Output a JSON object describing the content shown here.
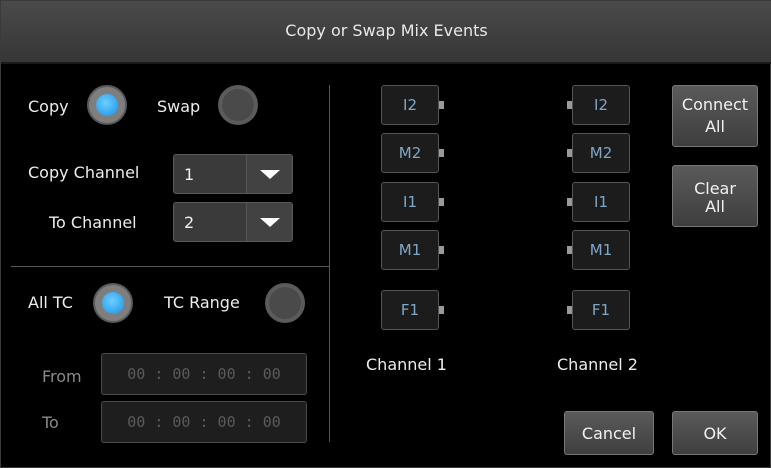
{
  "window": {
    "title": "Copy or Swap Mix Events"
  },
  "mode": {
    "copy_label": "Copy",
    "swap_label": "Swap",
    "selected": "Copy"
  },
  "channels": {
    "copy_label": "Copy Channel",
    "copy_value": "1",
    "to_label": "To Channel",
    "to_value": "2"
  },
  "tc": {
    "all_label": "All TC",
    "range_label": "TC Range",
    "selected": "All TC",
    "from_label": "From",
    "from_value": "00 : 00 : 00 : 00",
    "to_label": "To",
    "to_value": "00 : 00 : 00 : 00"
  },
  "events": {
    "channel1": {
      "label": "Channel 1",
      "items": [
        "I2",
        "M2",
        "I1",
        "M1",
        "F1"
      ]
    },
    "channel2": {
      "label": "Channel 2",
      "items": [
        "I2",
        "M2",
        "I1",
        "M1",
        "F1"
      ]
    }
  },
  "buttons": {
    "connect_all": [
      "Connect",
      "All"
    ],
    "clear_all": [
      "Clear",
      "All"
    ],
    "cancel": "Cancel",
    "ok": "OK"
  },
  "colors": {
    "accent": "#1a8fe6",
    "event_text": "#7fa7c9",
    "background": "#000000"
  }
}
